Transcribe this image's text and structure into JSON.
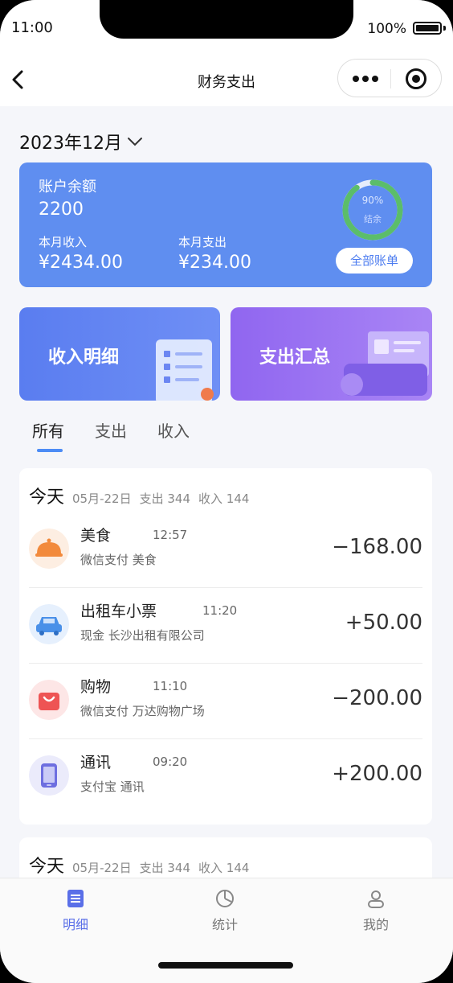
{
  "status": {
    "time": "11:00",
    "battery": "100%"
  },
  "nav": {
    "title": "财务支出",
    "back_icon": "back-arrow-icon",
    "more_icon": "more-dots-icon",
    "target_icon": "target-icon"
  },
  "month": {
    "label": "2023年12月"
  },
  "balance": {
    "label": "账户余额",
    "amount": "2200",
    "income_label": "本月收入",
    "income": "¥2434.00",
    "expense_label": "本月支出",
    "expense": "¥234.00",
    "ring_percent": "90%",
    "ring_label": "结余",
    "ring_value": 0.9,
    "all_bills": "全部账单"
  },
  "promos": {
    "income_detail": "收入明细",
    "expense_summary": "支出汇总"
  },
  "tabs": [
    {
      "label": "所有"
    },
    {
      "label": "支出"
    },
    {
      "label": "收入"
    }
  ],
  "days": [
    {
      "title": "今天",
      "date": "05月-22日",
      "expense": "支出 344",
      "income": "收入 144",
      "items": [
        {
          "name": "美食",
          "time": "12:57",
          "sub": "微信支付 美食",
          "amount": "−168.00",
          "icon": "food-cloche-icon"
        },
        {
          "name": "出租车小票",
          "time": "11:20",
          "sub": "现金 长沙出租有限公司",
          "amount": "+50.00",
          "icon": "taxi-icon"
        },
        {
          "name": "购物",
          "time": "11:10",
          "sub": "微信支付 万达购物广场",
          "amount": "−200.00",
          "icon": "shopping-bag-icon"
        },
        {
          "name": "通讯",
          "time": "09:20",
          "sub": "支付宝 通讯",
          "amount": "+200.00",
          "icon": "phone-icon"
        }
      ]
    },
    {
      "title": "今天",
      "date": "05月-22日",
      "expense": "支出 344",
      "income": "收入 144",
      "items": []
    }
  ],
  "bottom_nav": [
    {
      "label": "明细",
      "icon": "list-icon",
      "active": true
    },
    {
      "label": "统计",
      "icon": "pie-chart-icon",
      "active": false
    },
    {
      "label": "我的",
      "icon": "user-icon",
      "active": false
    }
  ],
  "colors": {
    "primary": "#5f8ef0",
    "accent_tab": "#4c8cf5",
    "active_nav": "#5a6fe8"
  }
}
